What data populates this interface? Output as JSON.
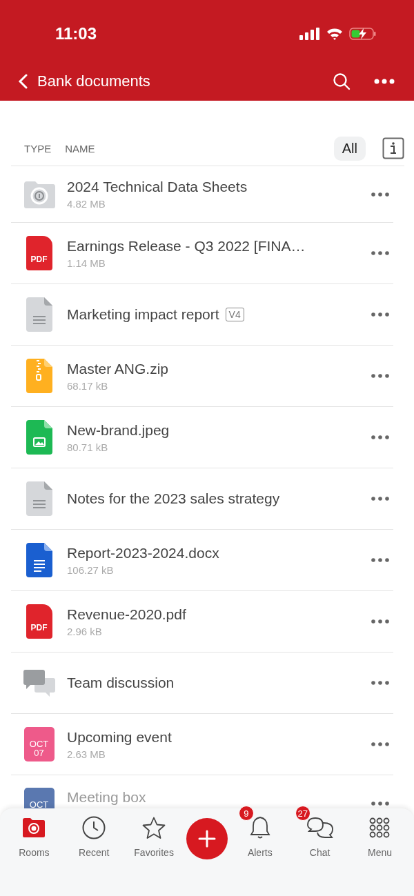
{
  "status_bar": {
    "time": "11:03"
  },
  "header": {
    "title": "Bank documents"
  },
  "columns": {
    "type": "TYPE",
    "name": "NAME",
    "filter": "All"
  },
  "files": [
    {
      "kind": "room",
      "name": "2024 Technical Data Sheets",
      "size": "4.82 MB"
    },
    {
      "kind": "pdf",
      "icon_text": "PDF",
      "name": "Earnings Release - Q3 2022 [FINA…",
      "size": "1.14 MB"
    },
    {
      "kind": "doc",
      "name": "Marketing impact report",
      "version": "V4"
    },
    {
      "kind": "zip",
      "name": "Master ANG.zip",
      "size": "68.17 kB"
    },
    {
      "kind": "image",
      "name": "New-brand.jpeg",
      "size": "80.71 kB"
    },
    {
      "kind": "doc",
      "name": "Notes for the 2023 sales strategy"
    },
    {
      "kind": "word",
      "name": "Report-2023-2024.docx",
      "size": "106.27 kB"
    },
    {
      "kind": "pdf",
      "icon_text": "PDF",
      "name": "Revenue-2020.pdf",
      "size": "2.96 kB"
    },
    {
      "kind": "chat",
      "name": "Team discussion"
    },
    {
      "kind": "event",
      "icon_text": "OCT",
      "icon_day": "07",
      "color": "#ee5a8a",
      "name": "Upcoming event",
      "size": "2.63 MB"
    },
    {
      "kind": "event",
      "icon_text": "OCT",
      "color": "#5a78b0",
      "name": "Meeting box"
    }
  ],
  "nav": [
    {
      "kind": "rooms",
      "label": "Rooms",
      "selected": true
    },
    {
      "kind": "recent",
      "label": "Recent",
      "selected": false
    },
    {
      "kind": "favorites",
      "label": "Favorites",
      "selected": false
    },
    {
      "kind": "add"
    },
    {
      "kind": "alerts",
      "label": "Alerts",
      "badge": "9",
      "selected": false
    },
    {
      "kind": "chat",
      "label": "Chat",
      "badge": "27",
      "selected": false
    },
    {
      "kind": "menu",
      "label": "Menu",
      "selected": false
    }
  ]
}
